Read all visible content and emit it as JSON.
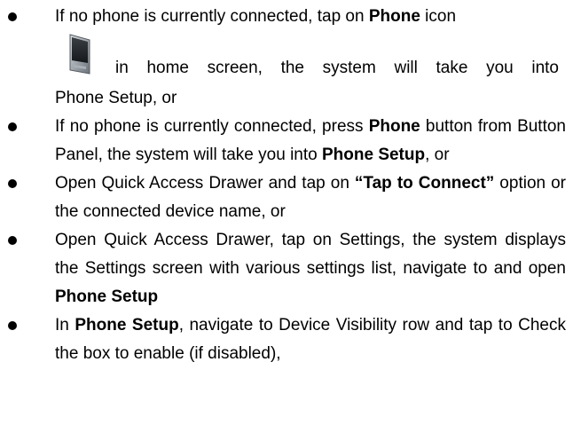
{
  "items": [
    {
      "line1_pre": "If no phone is currently connected, tap on ",
      "line1_bold": "Phone",
      "line1_post": " icon",
      "line2": "in home screen, the system will take you into",
      "line3": "Phone Setup, or",
      "icon": "phone-device-icon"
    },
    {
      "pre": "If no phone is currently connected, press ",
      "bold1": "Phone",
      "mid": " button from Button Panel, the system will take you into ",
      "bold2": "Phone Setup",
      "post": ", or"
    },
    {
      "pre": "Open Quick Access Drawer and tap on ",
      "bold1": "“Tap to Connect”",
      "post": " option or the connected device name, or"
    },
    {
      "pre": "Open Quick Access Drawer, tap on Settings, the system displays the Settings screen with various settings list, navigate to and open ",
      "bold1": "Phone Setup"
    },
    {
      "pre": "In ",
      "bold1": "Phone Setup",
      "post": ", navigate to Device Visibility row and tap to Check the box to enable (if disabled),"
    }
  ]
}
